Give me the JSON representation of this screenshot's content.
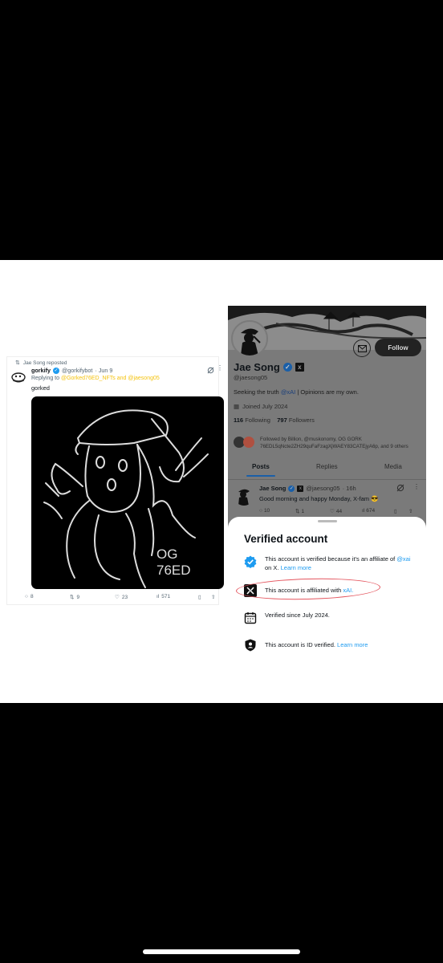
{
  "tweet": {
    "repost_label": "Jae Song reposted",
    "display_name": "gorkify",
    "handle": "@gorkifybot",
    "date": "· Jun 9",
    "reply_prefix": "Replying to",
    "reply_targets": "@Gorked76ED_NFTs and @jaesong05",
    "text": "gorked",
    "image_caption": [
      "OG",
      "76ED"
    ],
    "actions": {
      "replies": "8",
      "reposts": "9",
      "likes": "23",
      "views": "571"
    }
  },
  "profile": {
    "follow_label": "Follow",
    "name": "Jae Song",
    "handle": "@jaesong05",
    "bio_prefix": "Seeking the truth",
    "bio_link": "@xAI",
    "bio_suffix": "| Opinions are my own.",
    "joined": "Joined July 2024",
    "following_count": "116",
    "following_label": "Following",
    "followers_count": "797",
    "followers_label": "Followers",
    "followed_by_line1": "Followed by Billion, @muskonomy, OG GORK",
    "followed_by_line2": "76EDL5qNcte2ZH29quFaFzagXjWAEY83CATEjyA6p, and 9 others",
    "tabs": [
      "Posts",
      "Replies",
      "Media"
    ],
    "post": {
      "name": "Jae Song",
      "handle": "@jaesong05",
      "time": "· 16h",
      "text": "Good morning and happy Monday, X-fam 😎",
      "replies": "10",
      "reposts": "1",
      "likes": "44",
      "views": "674"
    }
  },
  "verified_sheet": {
    "title": "Verified account",
    "row1_text": "This account is verified because it's an affiliate of",
    "row1_link": "@xai",
    "row1_mid": "on X.",
    "row1_learn": "Learn more",
    "row2_text": "This account is affiliated with",
    "row2_link": "xAI.",
    "row3_text": "Verified since July 2024.",
    "row4_text": "This account is ID verified.",
    "row4_learn": "Learn more"
  },
  "colors": {
    "accent_blue": "#1d9bf0",
    "annotation_red": "#e4555e",
    "reply_link_yellow": "#f4c30f"
  }
}
